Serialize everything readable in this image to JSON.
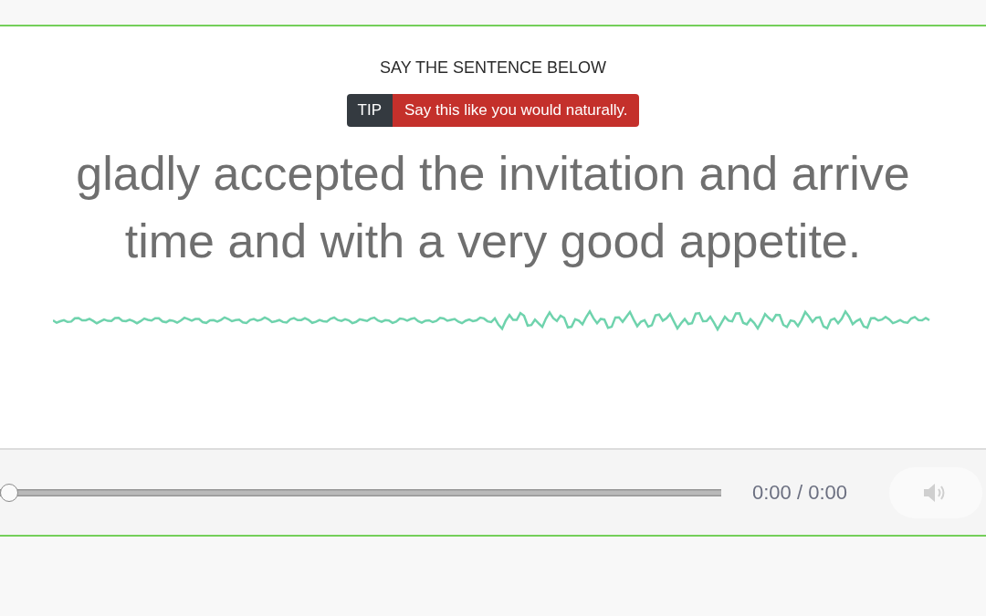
{
  "prompt": {
    "heading": "SAY THE SENTENCE BELOW",
    "tip": {
      "label": "TIP",
      "text": "Say this like you would naturally."
    },
    "sentence_lines": [
      "gladly accepted the invitation and arrive",
      "time and with a very good appetite."
    ]
  },
  "player": {
    "progress": {
      "level": 0
    },
    "time": "0:00 / 0:00",
    "muted": false
  }
}
